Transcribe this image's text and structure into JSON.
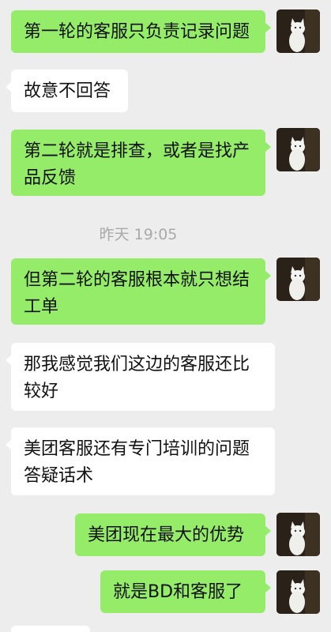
{
  "conversation": {
    "messages": [
      {
        "side": "me",
        "text": "第一轮的客服只负责记录问题"
      },
      {
        "side": "other",
        "text": "故意不回答"
      },
      {
        "side": "me",
        "text": "第二轮就是排查，或者是找产品反馈"
      },
      {
        "side": "me",
        "text": "但第二轮的客服根本就只想结工单"
      },
      {
        "side": "other",
        "text": "那我感觉我们这边的客服还比较好"
      },
      {
        "side": "other",
        "text": "美团客服还有专门培训的问题答疑话术"
      },
      {
        "side": "me",
        "text": "美团现在最大的优势"
      },
      {
        "side": "me",
        "text": "就是BD和客服了"
      }
    ],
    "timestamp": "昨天 19:05"
  },
  "colors": {
    "background": "#ededed",
    "me_bubble": "#95ec69",
    "other_bubble": "#ffffff",
    "timestamp_text": "#a9a9a9"
  },
  "icons": {
    "avatar": "white-cat-avatar-icon"
  }
}
